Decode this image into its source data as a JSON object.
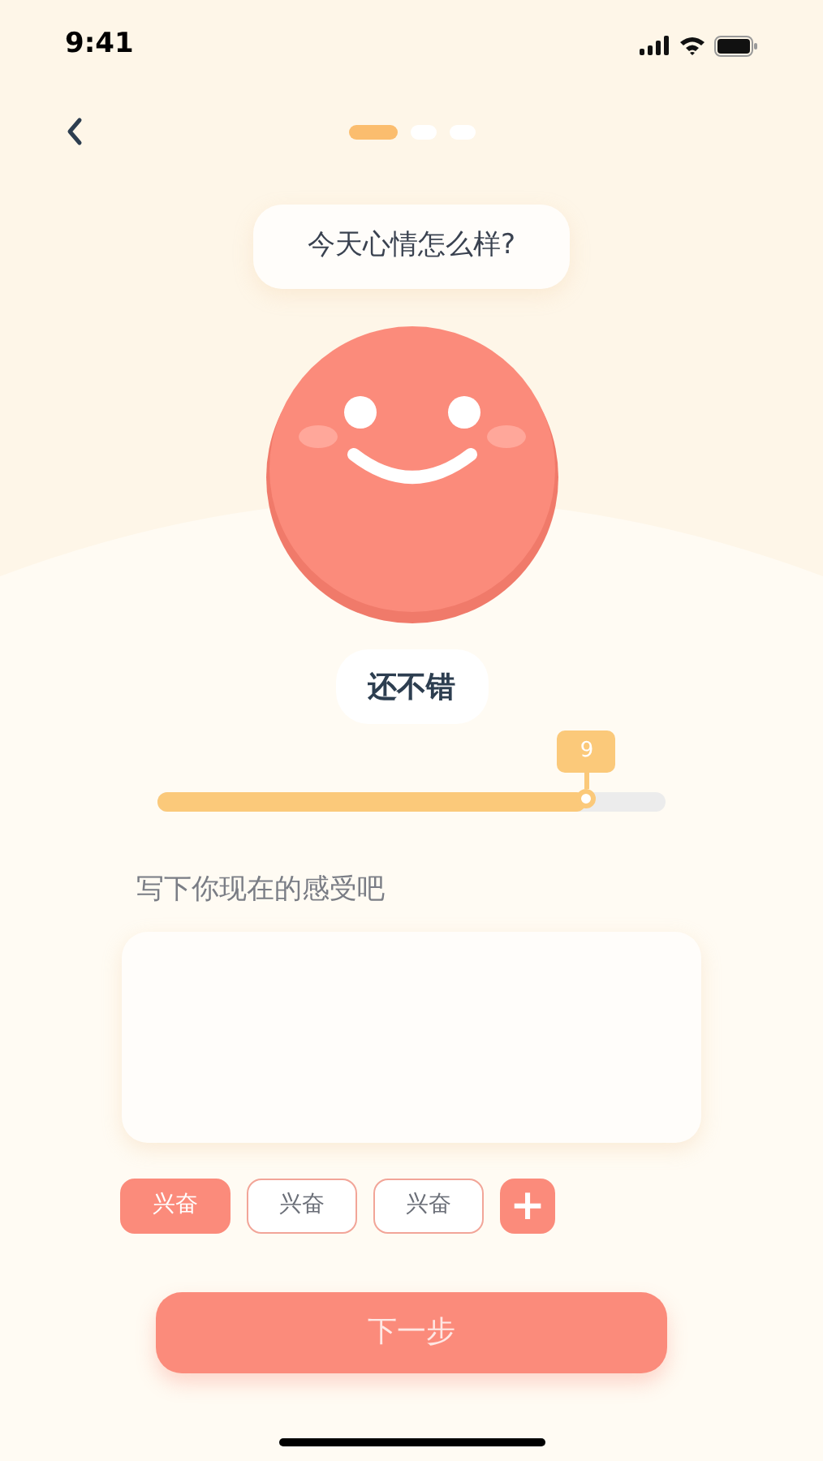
{
  "status_bar": {
    "time": "9:41"
  },
  "steps": [
    {
      "selected": true
    },
    {
      "selected": false
    },
    {
      "selected": false
    }
  ],
  "question": "今天心情怎么样?",
  "mood": {
    "label": "还不错",
    "value": "9",
    "level": 0.845
  },
  "note": {
    "label": "写下你现在的感受吧"
  },
  "tags": [
    {
      "label": "兴奋",
      "selected": true
    },
    {
      "label": "兴奋",
      "selected": false
    },
    {
      "label": "兴奋",
      "selected": false
    }
  ],
  "add_tag": "+",
  "next_button": "下一步"
}
